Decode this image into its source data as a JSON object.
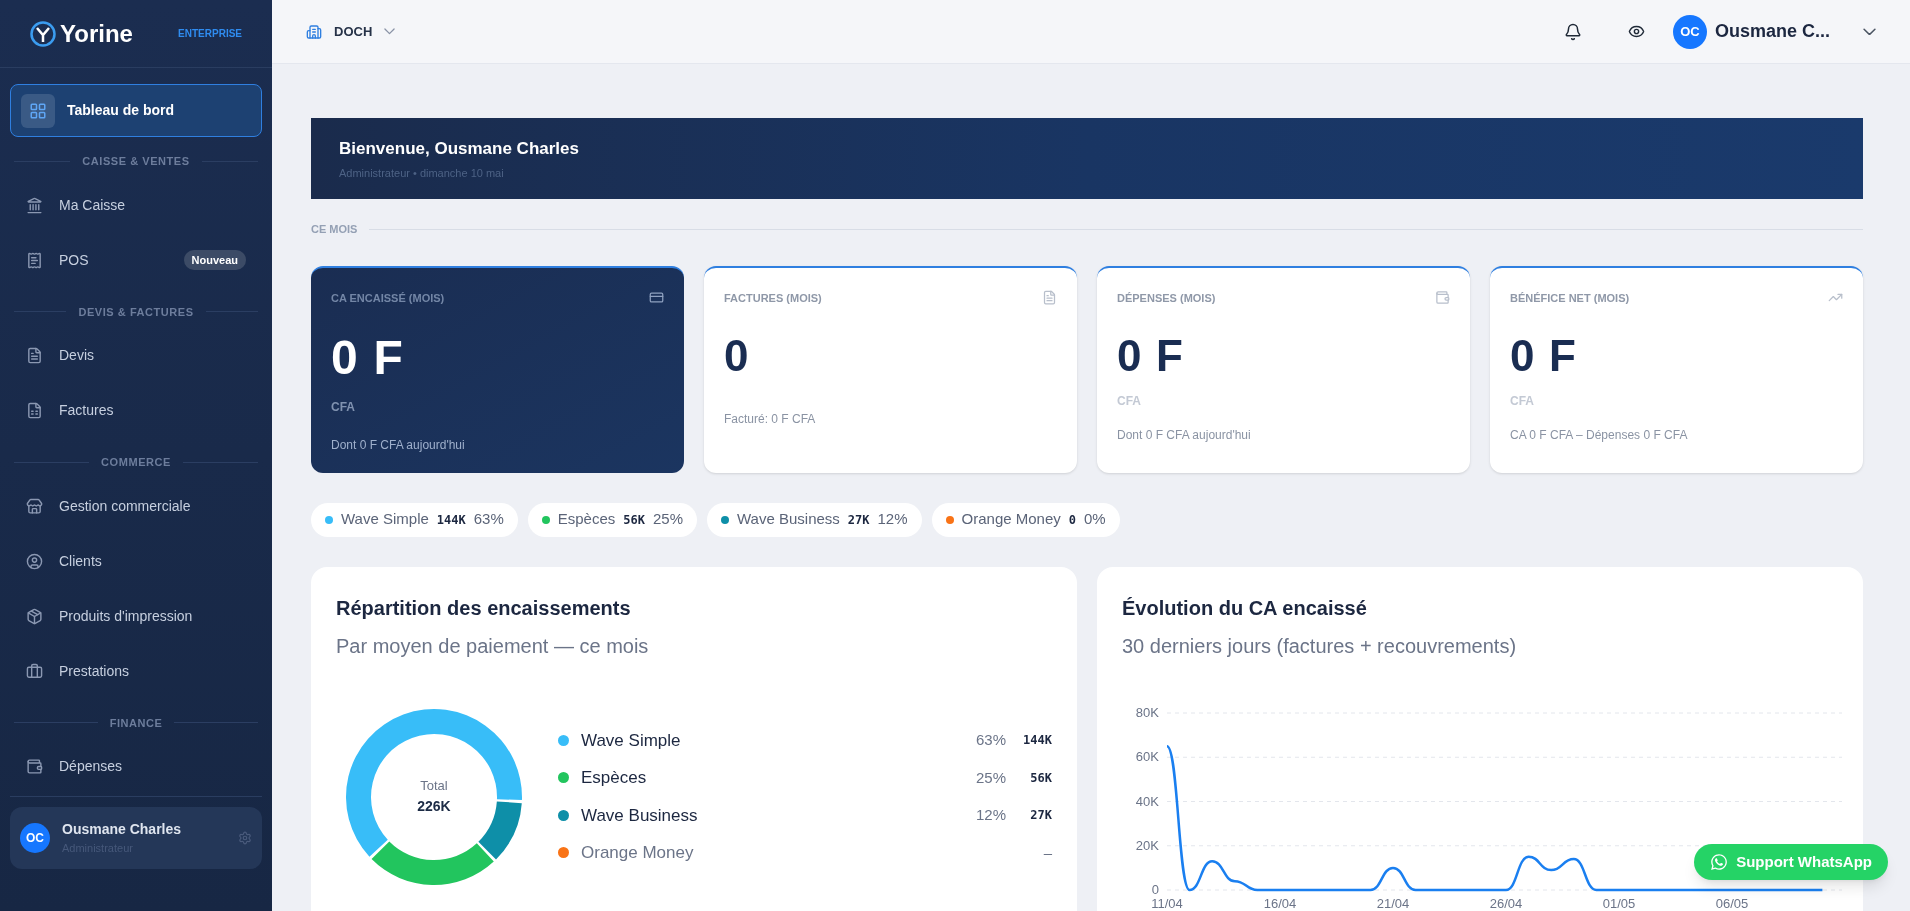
{
  "sidebar": {
    "logo": "Yorine",
    "plan": "ENTERPRISE",
    "sections": [
      {
        "items": [
          {
            "label": "Tableau de bord",
            "selected": true
          }
        ]
      },
      {
        "title": "CAISSE & VENTES",
        "items": [
          {
            "label": "Ma Caisse",
            "selected": false
          },
          {
            "label": "POS",
            "selected": false,
            "badge": "Nouveau"
          }
        ]
      },
      {
        "title": "DEVIS & FACTURES",
        "items": [
          {
            "label": "Devis",
            "selected": false
          },
          {
            "label": "Factures",
            "selected": false
          }
        ]
      },
      {
        "title": "COMMERCE",
        "items": [
          {
            "label": "Gestion commerciale",
            "selected": false
          },
          {
            "label": "Clients",
            "selected": false
          },
          {
            "label": "Produits d'impression",
            "selected": false
          },
          {
            "label": "Prestations",
            "selected": false
          }
        ]
      },
      {
        "title": "FINANCE",
        "items": [
          {
            "label": "Dépenses",
            "selected": false
          }
        ]
      }
    ],
    "user": {
      "initials": "OC",
      "name": "Ousmane Charles",
      "role": "Administrateur"
    }
  },
  "header": {
    "company": "DOCH",
    "user": {
      "initials": "OC",
      "name": "Ousmane C..."
    }
  },
  "welcome": {
    "title": "Bienvenue, Ousmane Charles",
    "subtitle": "Administrateur • dimanche 10 mai"
  },
  "section_label": "CE MOIS",
  "kpis": [
    {
      "kind": "highlight",
      "label": "CA ENCAISSÉ (MOIS)",
      "value": "0 F",
      "unit": "CFA",
      "note": "Dont 0 F CFA aujourd'hui"
    },
    {
      "kind": "plain",
      "label": "FACTURES (MOIS)",
      "value": "0",
      "note": "Facturé: 0 F CFA"
    },
    {
      "kind": "plain",
      "label": "DÉPENSES (MOIS)",
      "value": "0 F",
      "unit": "CFA",
      "note": "Dont 0 F CFA aujourd'hui"
    },
    {
      "kind": "plain",
      "label": "BÉNÉFICE NET (MOIS)",
      "value": "0 F",
      "unit": "CFA",
      "note": "CA 0 F CFA – Dépenses 0 F CFA"
    }
  ],
  "pills": [
    {
      "name": "Wave Simple",
      "color": "#38bdf8",
      "amount": "144K",
      "pct": "63%"
    },
    {
      "name": "Espèces",
      "color": "#22c55e",
      "amount": "56K",
      "pct": "25%"
    },
    {
      "name": "Wave Business",
      "color": "#0e8fa8",
      "amount": "27K",
      "pct": "12%"
    },
    {
      "name": "Orange Money",
      "color": "#f97316",
      "amount": "0",
      "pct": "0%"
    }
  ],
  "breakdown": {
    "title": "Répartition des encaissements",
    "subtitle": "Par moyen de paiement — ce mois",
    "center_label": "Total",
    "center_value": "226K",
    "chart_data": {
      "type": "donut",
      "categories": [
        "Wave Simple",
        "Espèces",
        "Wave Business",
        "Orange Money"
      ],
      "values": [
        63,
        25,
        12,
        0
      ]
    },
    "legend": [
      {
        "color": "#38bdf8",
        "pct": "63%",
        "amount": "144K",
        "muted": false
      },
      {
        "color": "#22c55e",
        "pct": "25%",
        "amount": "56K",
        "muted": false
      },
      {
        "color": "#0e8fa8",
        "pct": "12%",
        "amount": "27K",
        "muted": false
      },
      {
        "color": "#f97316",
        "pct": "–",
        "muted": true
      }
    ]
  },
  "trend": {
    "title": "Évolution du CA encaissé",
    "subtitle": "30 derniers jours (factures + recouvrements)",
    "chart_data": {
      "type": "line",
      "grid": true,
      "x": [
        "11/04",
        null,
        null,
        null,
        null,
        "16/04",
        null,
        null,
        null,
        null,
        "21/04",
        null,
        null,
        null,
        null,
        "26/04",
        null,
        null,
        null,
        null,
        "01/05",
        null,
        null,
        null,
        null,
        "06/05",
        null,
        null,
        null,
        null
      ],
      "series": [
        {
          "color": "#1a7ff0",
          "values": [
            65000,
            0,
            13000,
            4000,
            0,
            0,
            0,
            0,
            0,
            0,
            10000,
            0,
            0,
            0,
            0,
            0,
            15000,
            9000,
            14000,
            0,
            0,
            0,
            0,
            0,
            0,
            0,
            0,
            0,
            0,
            0
          ]
        }
      ],
      "ylim": [
        0,
        80000
      ],
      "yticks": [
        {
          "value": 0,
          "label": "0"
        },
        {
          "value": 20000,
          "label": "20K"
        },
        {
          "value": 40000,
          "label": "40K"
        },
        {
          "value": 60000,
          "label": "60K"
        },
        {
          "value": 80000,
          "label": "80K"
        }
      ]
    }
  },
  "support_button": "Support WhatsApp"
}
